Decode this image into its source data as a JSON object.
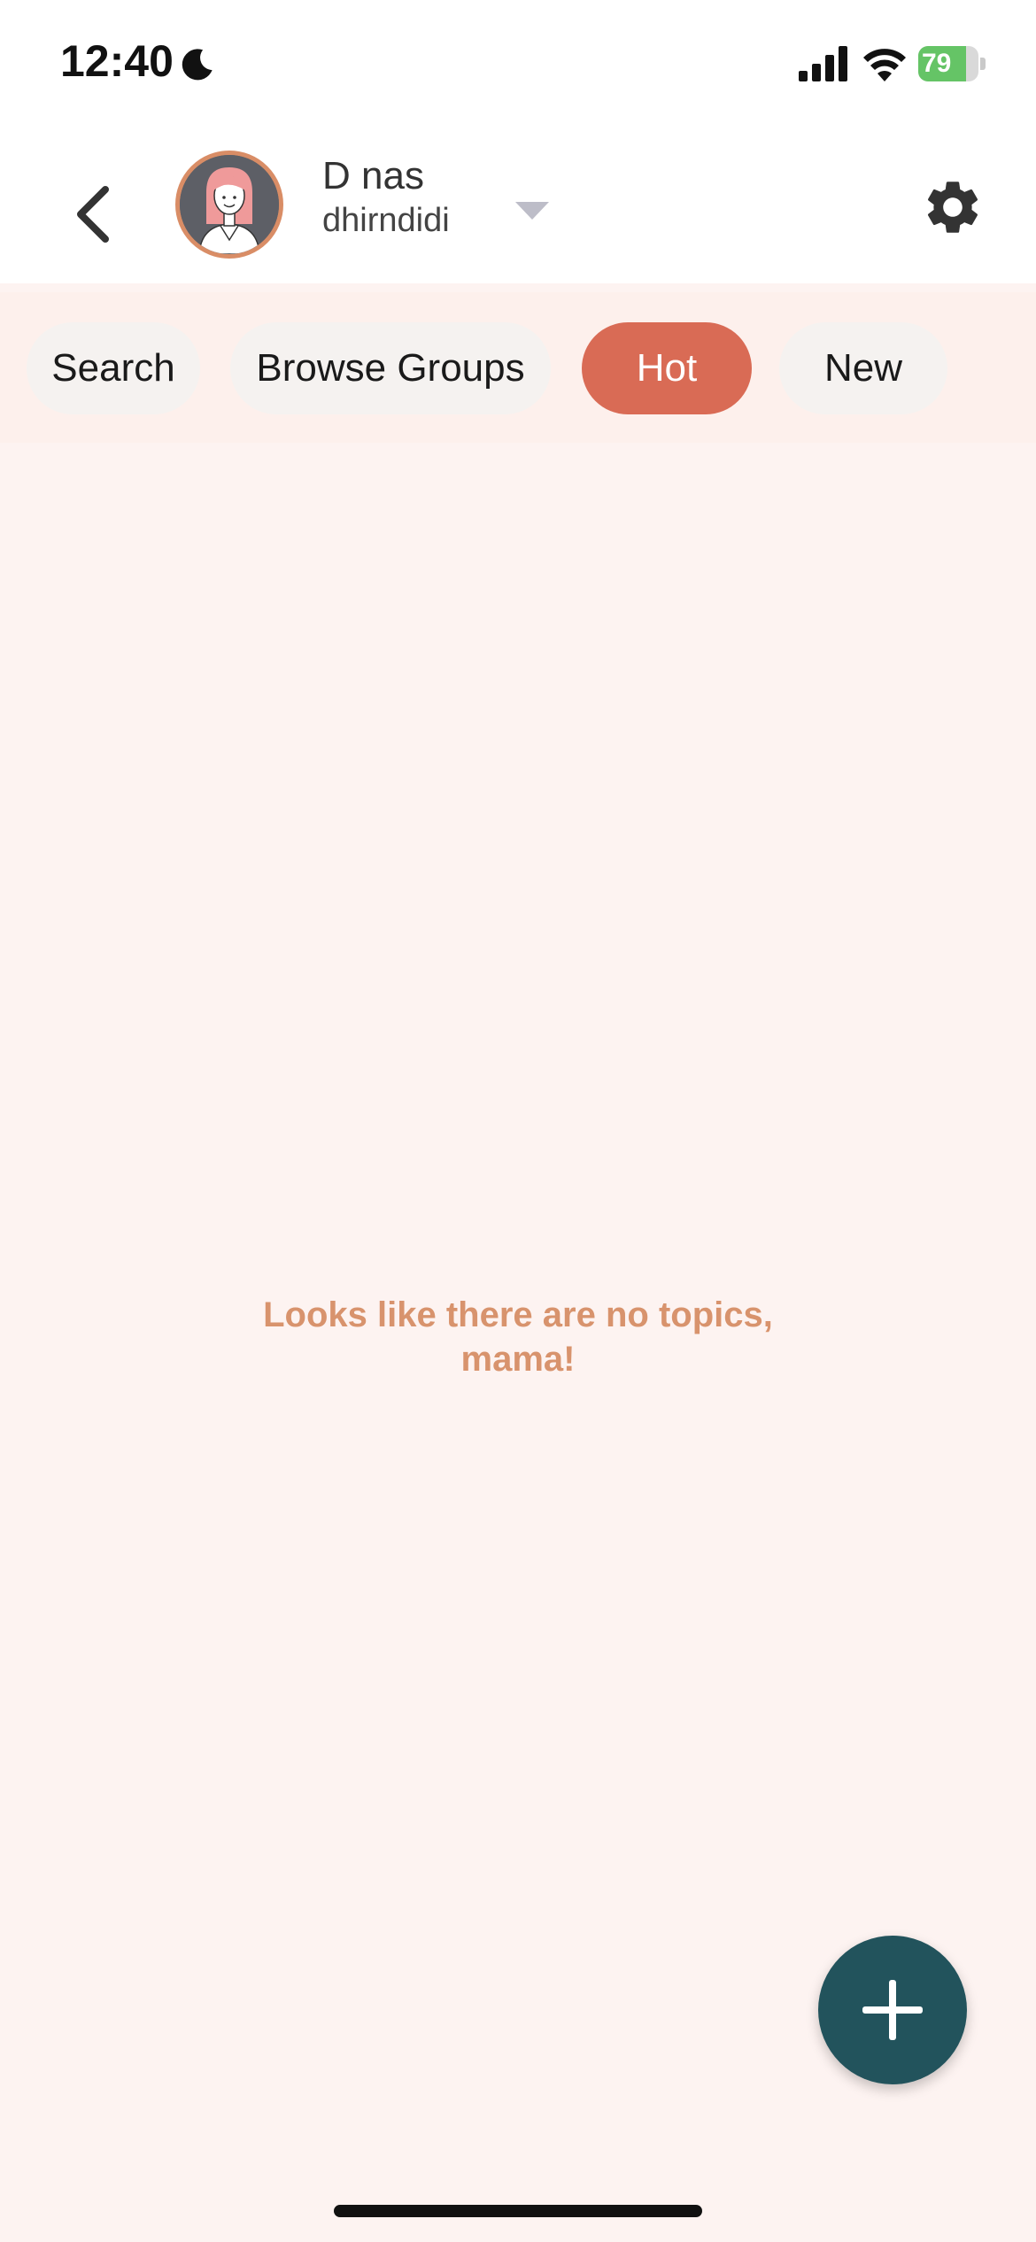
{
  "status_bar": {
    "time": "12:40",
    "battery_text": "79",
    "battery_level": 0.79,
    "icons": [
      "moon-icon",
      "signal-icon",
      "wifi-icon",
      "battery-icon"
    ]
  },
  "header": {
    "user_name": "D nas",
    "user_handle": "dhirndidi",
    "icons": [
      "back-arrow-icon",
      "avatar",
      "chevron-down-icon",
      "gear-icon"
    ]
  },
  "tabs": [
    {
      "label": "Search",
      "active": false
    },
    {
      "label": "Browse Groups",
      "active": false
    },
    {
      "label": "Hot",
      "active": true
    },
    {
      "label": "New",
      "active": false
    }
  ],
  "empty_state": {
    "message": "Looks like there are no topics, mama!"
  },
  "fab": {
    "icon": "plus-icon"
  },
  "colors": {
    "accent_active_tab": "#d96b55",
    "fab": "#22535c",
    "empty_text": "#d8936d",
    "background": "#fdf3f1",
    "avatar_border": "#d98d66"
  }
}
